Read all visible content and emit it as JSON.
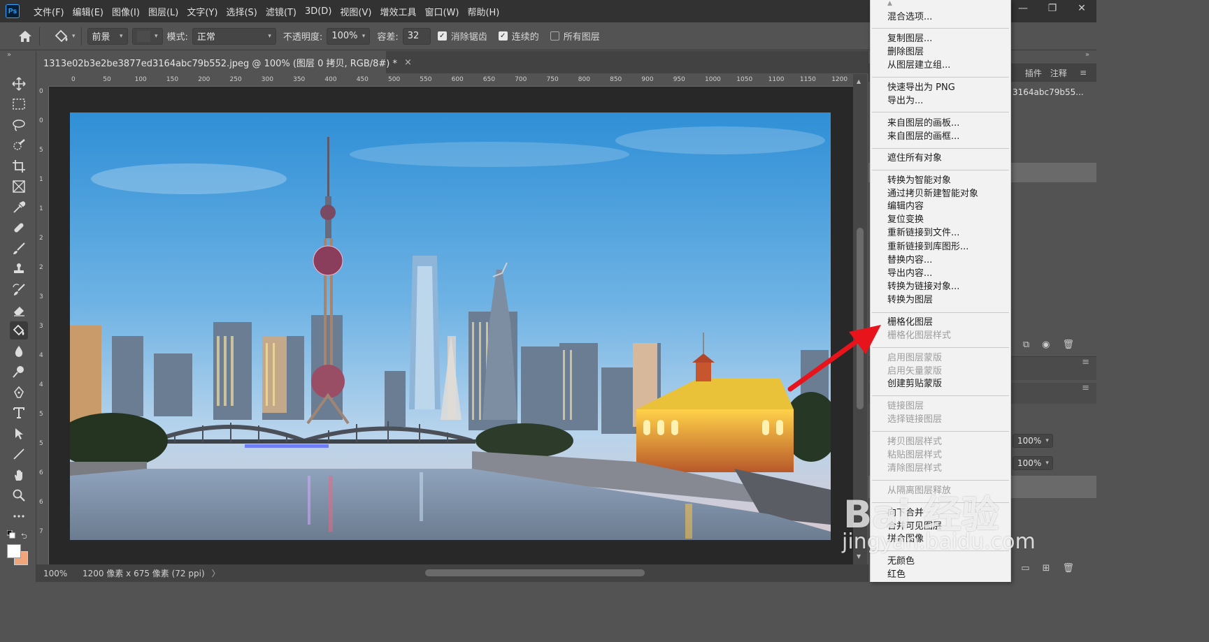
{
  "menubar": {
    "app_logo": "Ps",
    "items": [
      "文件(F)",
      "编辑(E)",
      "图像(I)",
      "图层(L)",
      "文字(Y)",
      "选择(S)",
      "滤镜(T)",
      "3D(D)",
      "视图(V)",
      "增效工具",
      "窗口(W)",
      "帮助(H)"
    ]
  },
  "window_controls": {
    "minimize": "—",
    "restore": "❐",
    "close": "✕"
  },
  "options": {
    "fill_source": "前景",
    "mode_label": "模式:",
    "mode_value": "正常",
    "opacity_label": "不透明度:",
    "opacity_value": "100%",
    "tolerance_label": "容差:",
    "tolerance_value": "32",
    "antialias_label": "消除锯齿",
    "contiguous_label": "连续的",
    "all_layers_label": "所有图层"
  },
  "document": {
    "tab_title": "1313e02b3e2be3877ed3164abc79b552.jpeg @ 100% (图层 0 拷贝, RGB/8#) *",
    "close": "×"
  },
  "ruler_h_labels": [
    "0",
    "50",
    "100",
    "150",
    "200",
    "250",
    "300",
    "350",
    "400",
    "450",
    "500",
    "550",
    "600",
    "650",
    "700",
    "750",
    "800",
    "850",
    "900",
    "950",
    "1000",
    "1050",
    "1100",
    "1150",
    "1200"
  ],
  "ruler_v_labels": [
    "0",
    "0",
    "5",
    "1",
    "1",
    "2",
    "2",
    "3",
    "3",
    "4",
    "4",
    "5",
    "5",
    "6",
    "6",
    "7"
  ],
  "status": {
    "zoom": "100%",
    "doc_info": "1200 像素 x 675 像素 (72 ppi)",
    "arrow": "〉"
  },
  "right_panel": {
    "tab1": "插件",
    "tab2": "注释",
    "doc_snippet": "3164abc79b55...",
    "opacity1": "100%",
    "opacity2": "100%"
  },
  "context_menu": {
    "items": [
      {
        "label": "混合选项...",
        "disabled": false
      },
      {
        "label": "复制图层...",
        "disabled": false
      },
      {
        "label": "删除图层",
        "disabled": false
      },
      {
        "label": "从图层建立组...",
        "disabled": false
      },
      {
        "label": "快速导出为 PNG",
        "disabled": false
      },
      {
        "label": "导出为...",
        "disabled": false
      },
      {
        "label": "来自图层的画板...",
        "disabled": false
      },
      {
        "label": "来自图层的画框...",
        "disabled": false
      },
      {
        "label": "遮住所有对象",
        "disabled": false
      },
      {
        "label": "转换为智能对象",
        "disabled": false
      },
      {
        "label": "通过拷贝新建智能对象",
        "disabled": false
      },
      {
        "label": "编辑内容",
        "disabled": false
      },
      {
        "label": "复位变换",
        "disabled": false
      },
      {
        "label": "重新链接到文件...",
        "disabled": false
      },
      {
        "label": "重新链接到库图形...",
        "disabled": false
      },
      {
        "label": "替换内容...",
        "disabled": false
      },
      {
        "label": "导出内容...",
        "disabled": false
      },
      {
        "label": "转换为链接对象...",
        "disabled": false
      },
      {
        "label": "转换为图层",
        "disabled": false
      },
      {
        "label": "栅格化图层",
        "disabled": false
      },
      {
        "label": "栅格化图层样式",
        "disabled": true
      },
      {
        "label": "启用图层蒙版",
        "disabled": true
      },
      {
        "label": "启用矢量蒙版",
        "disabled": true
      },
      {
        "label": "创建剪贴蒙版",
        "disabled": false
      },
      {
        "label": "链接图层",
        "disabled": true
      },
      {
        "label": "选择链接图层",
        "disabled": true
      },
      {
        "label": "拷贝图层样式",
        "disabled": true
      },
      {
        "label": "粘贴图层样式",
        "disabled": true
      },
      {
        "label": "清除图层样式",
        "disabled": true
      },
      {
        "label": "从隔离图层释放",
        "disabled": true
      },
      {
        "label": "向下合并",
        "disabled": false
      },
      {
        "label": "合并可见图层",
        "disabled": false
      },
      {
        "label": "拼合图像",
        "disabled": false
      },
      {
        "label": "无颜色",
        "disabled": false
      },
      {
        "label": "红色",
        "disabled": false
      }
    ]
  },
  "watermark": {
    "brand": "Bai 经验",
    "url": "jingyan.baidu.com"
  },
  "colors": {
    "accent_arrow": "#e8141b",
    "menu_bg": "#f2f2f2",
    "ui_dark": "#323232",
    "ui_mid": "#535353"
  }
}
